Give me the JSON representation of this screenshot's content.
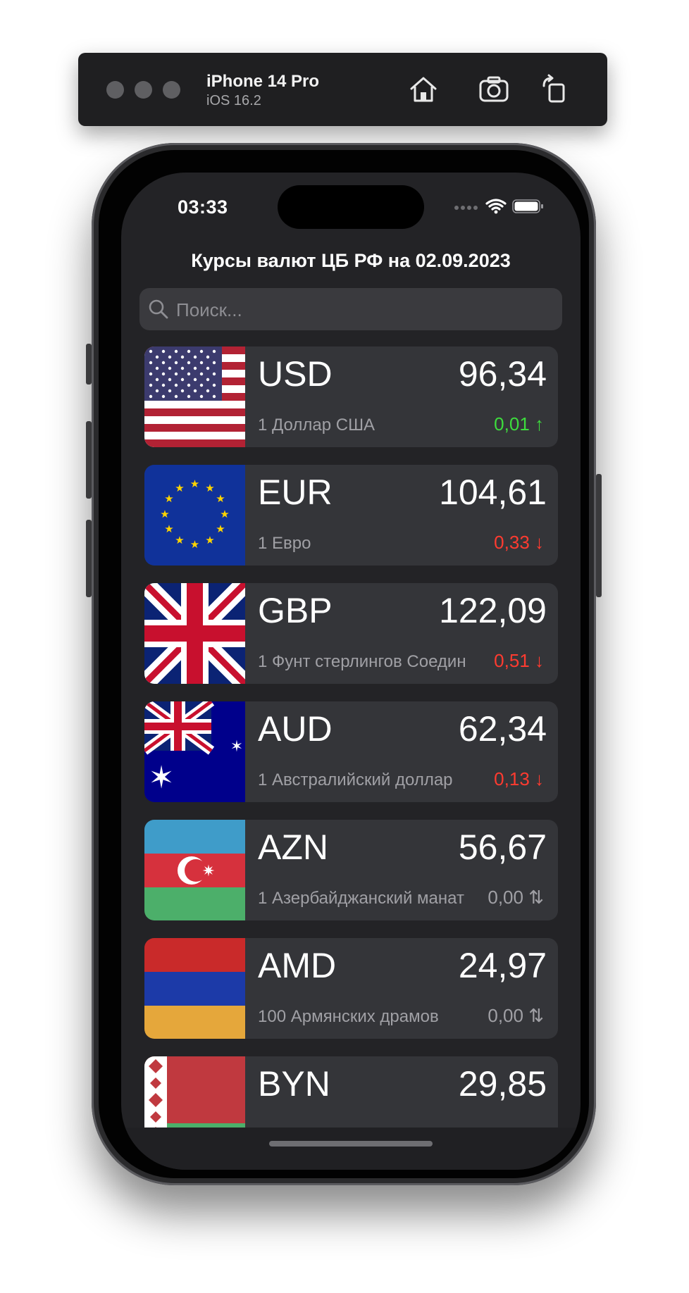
{
  "simulator": {
    "device_name": "iPhone 14 Pro",
    "os_version": "iOS 16.2",
    "toolbar_icons": [
      "home-icon",
      "camera-icon",
      "rotate-icon"
    ]
  },
  "status_bar": {
    "time": "03:33",
    "icons": [
      "cellular-icon",
      "wifi-icon",
      "battery-icon"
    ]
  },
  "nav": {
    "title": "Курсы валют ЦБ РФ на 02.09.2023"
  },
  "search": {
    "placeholder": "Поиск..."
  },
  "currencies": [
    {
      "code": "USD",
      "rate": "96,34",
      "name": "1 Доллар США",
      "change": "0,01 ↑",
      "trend": "up",
      "flag": "us-flag"
    },
    {
      "code": "EUR",
      "rate": "104,61",
      "name": "1 Евро",
      "change": "0,33 ↓",
      "trend": "down",
      "flag": "eu-flag"
    },
    {
      "code": "GBP",
      "rate": "122,09",
      "name": "1 Фунт стерлингов Соедин",
      "change": "0,51 ↓",
      "trend": "down",
      "flag": "uk-flag"
    },
    {
      "code": "AUD",
      "rate": "62,34",
      "name": "1 Австралийский доллар",
      "change": "0,13 ↓",
      "trend": "down",
      "flag": "au-flag"
    },
    {
      "code": "AZN",
      "rate": "56,67",
      "name": "1 Азербайджанский манат",
      "change": "0,00 ⇅",
      "trend": "flat",
      "flag": "az-flag"
    },
    {
      "code": "AMD",
      "rate": "24,97",
      "name": "100 Армянских драмов",
      "change": "0,00 ⇅",
      "trend": "flat",
      "flag": "am-flag"
    },
    {
      "code": "BYN",
      "rate": "29,85",
      "name": "",
      "change": "",
      "trend": "up",
      "flag": "by-flag"
    }
  ],
  "colors": {
    "background": "#232326",
    "card": "#343539",
    "up": "#3ddc3d",
    "down": "#ff3b30",
    "flat": "#a0a0a5"
  }
}
